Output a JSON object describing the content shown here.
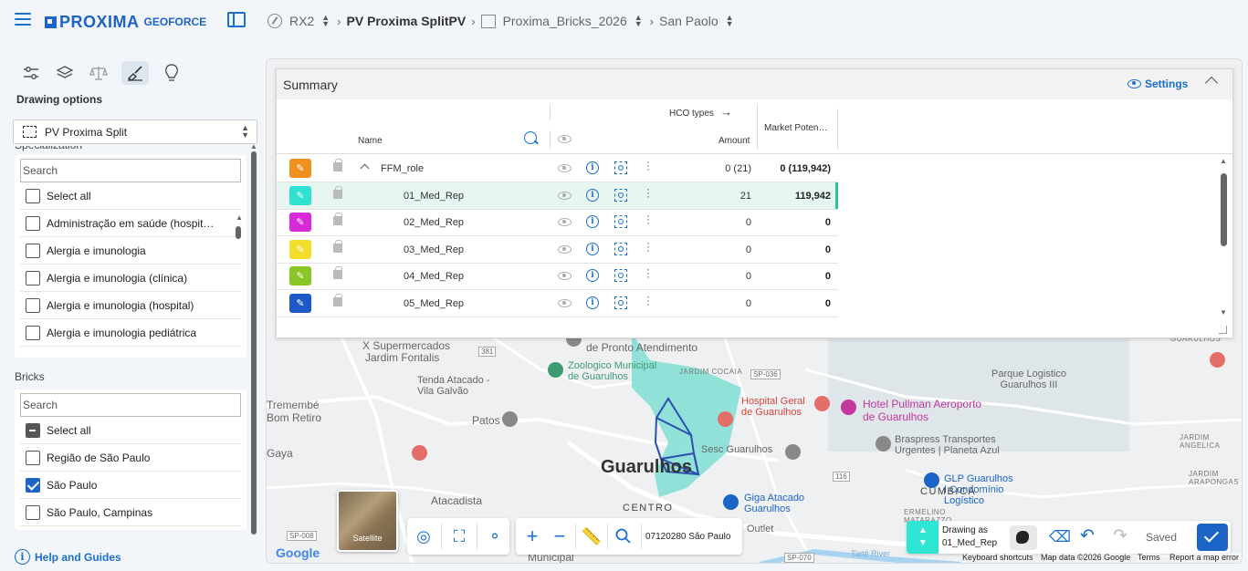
{
  "app": {
    "logo": "PROXIMA",
    "logo_sub": "GEOFORCE"
  },
  "breadcrumb": {
    "item1": "RX2",
    "item2": "PV Proxima SplitPV",
    "item3": "Proxima_Bricks_2026",
    "item4": "San Paolo"
  },
  "sidebar": {
    "drawing_title": "Drawing options",
    "drawing_select": "PV Proxima Split",
    "spec_title": "Specialization",
    "spec_search_placeholder": "Search",
    "spec_items": [
      {
        "label": "Select all",
        "state": "unchecked"
      },
      {
        "label": "Administração em saúde (hospit…",
        "state": "unchecked"
      },
      {
        "label": "Alergia e imunologia",
        "state": "unchecked"
      },
      {
        "label": "Alergia e imunologia (clínica)",
        "state": "unchecked"
      },
      {
        "label": "Alergia e imunologia (hospital)",
        "state": "unchecked"
      },
      {
        "label": "Alergia e imunologia pediátrica",
        "state": "unchecked"
      }
    ],
    "bricks_title": "Bricks",
    "bricks_search_placeholder": "Search",
    "bricks_items": [
      {
        "label": "Select all",
        "state": "partial"
      },
      {
        "label": "Região de São Paulo",
        "state": "unchecked"
      },
      {
        "label": "São Paulo",
        "state": "checked"
      },
      {
        "label": "São Paulo, Campinas",
        "state": "unchecked"
      }
    ],
    "help_link": "Help and Guides"
  },
  "summary": {
    "title": "Summary",
    "settings_label": "Settings",
    "col_name": "Name",
    "col_hco_types": "HCO types",
    "col_amount": "Amount",
    "col_market": "Market Poten…",
    "rows": [
      {
        "name": "FFM_role",
        "amount": "0 (21)",
        "market": "0 (119,942)",
        "color": "#f0901e"
      },
      {
        "name": "01_Med_Rep",
        "amount": "21",
        "market": "119,942",
        "color": "#30e0d0"
      },
      {
        "name": "02_Med_Rep",
        "amount": "0",
        "market": "0",
        "color": "#d92ad9"
      },
      {
        "name": "03_Med_Rep",
        "amount": "0",
        "market": "0",
        "color": "#f2dd2a"
      },
      {
        "name": "04_Med_Rep",
        "amount": "0",
        "market": "0",
        "color": "#8ac626"
      },
      {
        "name": "05_Med_Rep",
        "amount": "0",
        "market": "0",
        "color": "#1e58c8"
      }
    ]
  },
  "map": {
    "labels": {
      "guarulhos": "Guarulhos",
      "centro": "CENTRO",
      "cumbica": "CUMBICA",
      "supermercados": "X Supermercados",
      "jardim_fontalis": "Jardim Fontalis",
      "pronto_atendimento": "de Pronto Atendimento",
      "zoologico": "Zoologico Municipal de Guarulhos",
      "jardim_cocaia": "JARDIM COCAIA",
      "parque_logistico": "Parque Logistico Guarulhos III",
      "hospital_geral": "Hospital Geral de Guarulhos",
      "hotel_pullman": "Hotel Pullman Aeroporto de Guarulhos",
      "tenda_atacado": "Tenda Atacado - Vila Galvão",
      "tremembe": "Tremembé",
      "bom_retiro": "Bom Retiro",
      "patos": "Patos",
      "gaya": "Gaya",
      "atacadista": "Atacadista",
      "sesc": "Sesc Guarulhos",
      "braspress": "Braspress Transportes Urgentes | Planeta Azul",
      "glp": "GLP Guarulhos I Condomínio Logístico",
      "giga_atacado": "Giga Atacado Guarulhos",
      "ermelino": "ERMELINO MATARAZZO",
      "outlet": "Outlet",
      "guarulhos_label": "GUARULHOS",
      "jardim_arapongas": "JARDIM ARAPONGAS",
      "jardim_angelica": "JARDIM ANGELICA",
      "municipal": "Municipal",
      "tiete": "Tietê River",
      "satellite": "Satellite",
      "google": "Google",
      "sp036": "SP-036",
      "sp008": "SP-008",
      "sp070": "SP-070",
      "r381": "381",
      "r116": "116"
    },
    "search_value": "07120280 São Paulo",
    "drawing_as_label": "Drawing as",
    "drawing_as_value": "01_Med_Rep",
    "saved_label": "Saved",
    "footer": {
      "shortcuts": "Keyboard shortcuts",
      "map_data": "Map data ©2026 Google",
      "terms": "Terms",
      "report": "Report a map error"
    }
  }
}
